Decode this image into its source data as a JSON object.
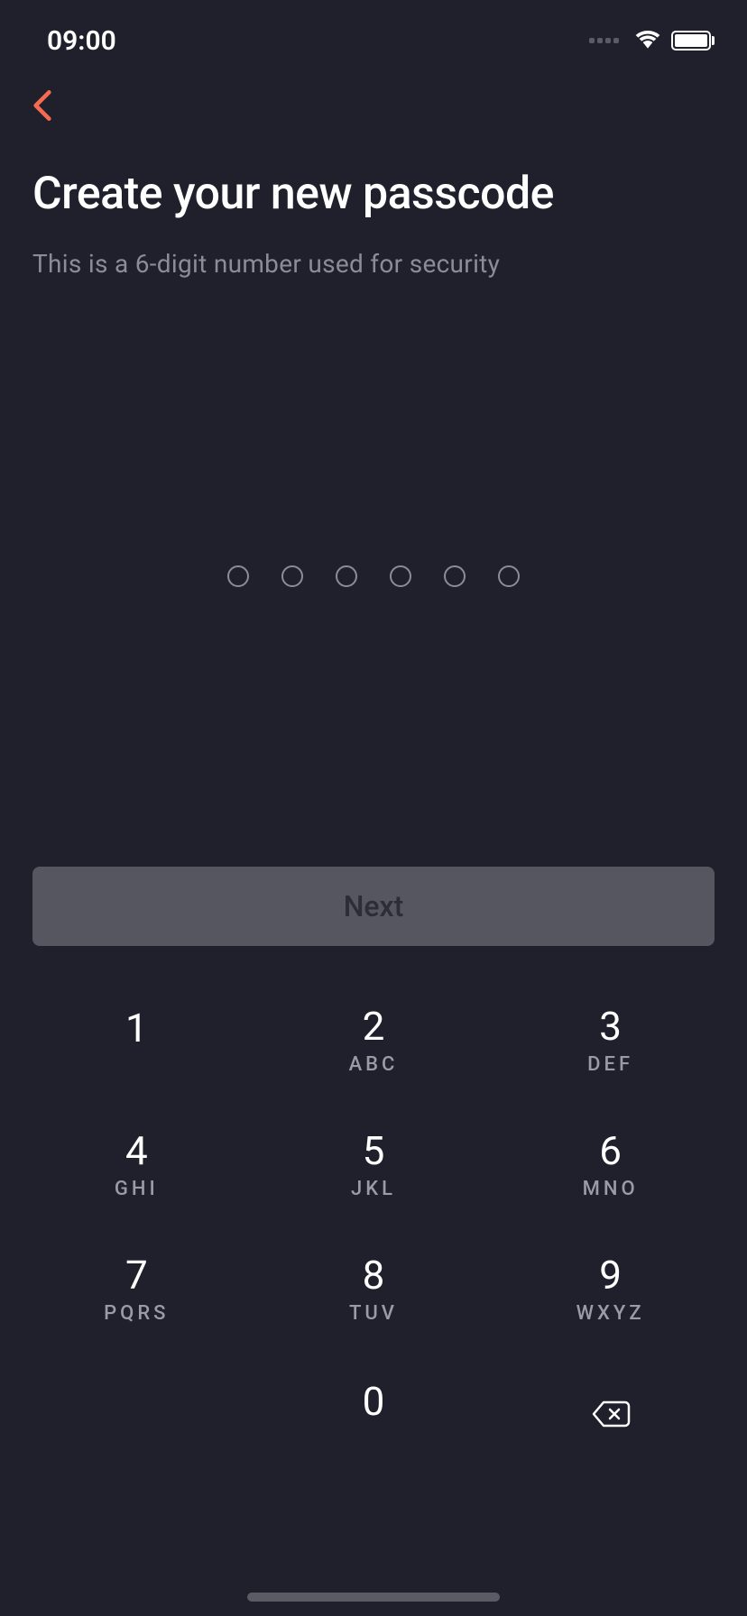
{
  "statusBar": {
    "time": "09:00"
  },
  "header": {
    "title": "Create your new passcode",
    "subtitle": "This is a 6-digit number used for security"
  },
  "passcode": {
    "length": 6,
    "filled": 0
  },
  "nextButton": {
    "label": "Next"
  },
  "keypad": {
    "keys": [
      {
        "digit": "1",
        "letters": ""
      },
      {
        "digit": "2",
        "letters": "ABC"
      },
      {
        "digit": "3",
        "letters": "DEF"
      },
      {
        "digit": "4",
        "letters": "GHI"
      },
      {
        "digit": "5",
        "letters": "JKL"
      },
      {
        "digit": "6",
        "letters": "MNO"
      },
      {
        "digit": "7",
        "letters": "PQRS"
      },
      {
        "digit": "8",
        "letters": "TUV"
      },
      {
        "digit": "9",
        "letters": "WXYZ"
      },
      {
        "digit": "0",
        "letters": ""
      }
    ]
  }
}
